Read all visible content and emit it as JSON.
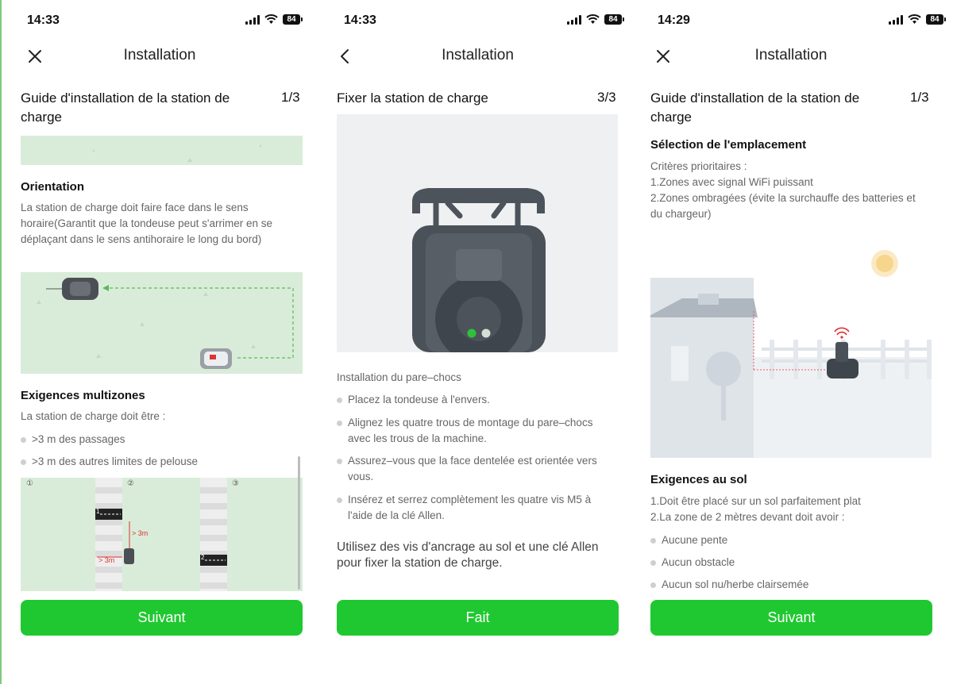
{
  "colors": {
    "accent": "#1fc830",
    "lawn": "#d9ecd9",
    "text_secondary": "#666666"
  },
  "panels": [
    {
      "time": "14:33",
      "battery": "84",
      "nav_icon": "close-icon",
      "title": "Installation",
      "heading": "Guide d'installation de la station de charge",
      "step": "1/3",
      "orientation_title": "Orientation",
      "orientation_text": "La station de charge doit faire face dans le sens horaire(Garantit que la tondeuse peut s'arrimer en se déplaçant dans le sens antihoraire le long du bord)",
      "multizone_title": "Exigences multizones",
      "multizone_intro": "La station de charge doit être :",
      "bullets": [
        ">3 m des passages",
        ">3 m des autres limites de pelouse"
      ],
      "zone_labels": [
        "①",
        "②",
        "③"
      ],
      "dist_labels": [
        "> 3m",
        "> 3m"
      ],
      "station_numbers": [
        "1",
        "2"
      ],
      "button": "Suivant"
    },
    {
      "time": "14:33",
      "battery": "84",
      "nav_icon": "back-chevron-icon",
      "title": "Installation",
      "heading": "Fixer la station de charge",
      "step": "3/3",
      "subtitle": "Installation du pare–chocs",
      "bullets": [
        "Placez la tondeuse à l'envers.",
        "Alignez les quatre trous de montage du pare–chocs avec les trous de la machine.",
        "Assurez–vous que la face dentelée est orientée vers vous.",
        " Insérez et serrez complètement les quatre vis M5 à l'aide de la clé Allen."
      ],
      "note": "Utilisez des vis d'ancrage au sol et une clé Allen pour fixer la station de charge.",
      "button": "Fait"
    },
    {
      "time": "14:29",
      "battery": "84",
      "nav_icon": "close-icon",
      "title": "Installation",
      "heading": "Guide d'installation de la station de charge",
      "step": "1/3",
      "location_title": "Sélection de l'emplacement",
      "criteria": "Critères prioritaires :\n1.Zones avec signal WiFi puissant\n2.Zones ombragées (évite la surchauffe des batteries et du chargeur)",
      "ground_title": "Exigences au sol",
      "ground_text": "1.Doit être placé sur un sol parfaitement plat\n2.La zone de 2 mètres devant doit avoir :",
      "bullets": [
        "Aucune pente",
        "Aucun obstacle",
        "Aucun sol nu/herbe clairsemée"
      ],
      "button": "Suivant"
    }
  ]
}
